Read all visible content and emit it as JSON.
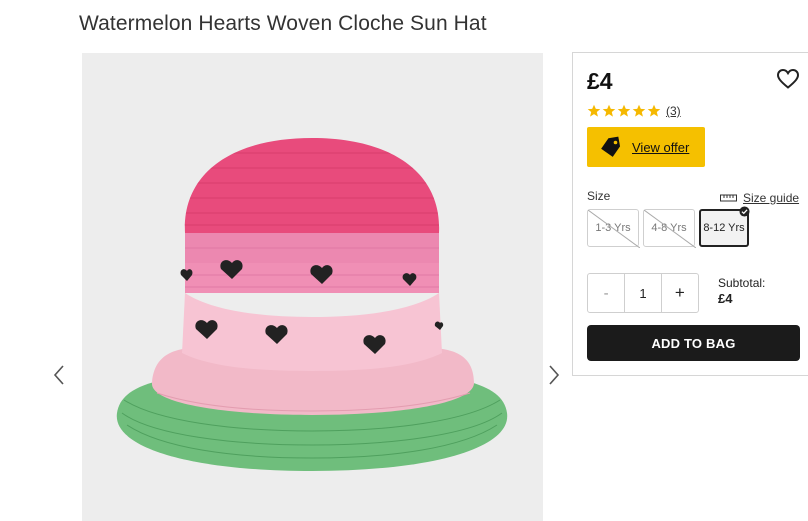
{
  "product": {
    "title": "Watermelon Hearts Woven Cloche Sun Hat",
    "image_alt": "Watermelon Hearts Woven Cloche Sun Hat"
  },
  "purchase": {
    "price": "£4",
    "rating_count": "(3)",
    "stars_filled": 5,
    "stars_total": 5,
    "offer_label": "View offer",
    "size_label": "Size",
    "size_guide_label": "Size guide",
    "sizes": [
      {
        "label": "1-3 Yrs",
        "available": false,
        "selected": false
      },
      {
        "label": "4-8 Yrs",
        "available": false,
        "selected": false
      },
      {
        "label": "8-12 Yrs",
        "available": true,
        "selected": true
      }
    ],
    "quantity": "1",
    "minus_label": "-",
    "plus_label": "+",
    "subtotal_label": "Subtotal:",
    "subtotal_value": "£4",
    "add_to_bag_label": "ADD TO BAG"
  },
  "colors": {
    "offer_yellow": "#f5c000",
    "star_gold": "#f5b800",
    "button_dark": "#1b1b1b"
  },
  "icons": {
    "prev": "chevron-left-icon",
    "next": "chevron-right-icon",
    "wishlist": "heart-icon",
    "offer": "tag-icon",
    "size_guide": "ruler-icon",
    "selected": "check-circle-icon"
  }
}
